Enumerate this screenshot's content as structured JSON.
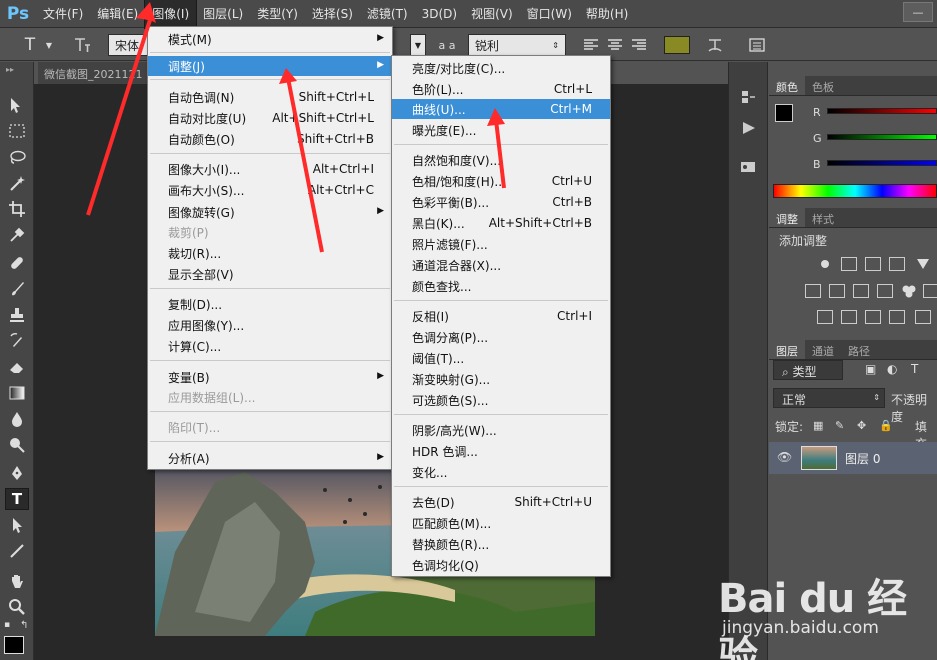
{
  "app": {
    "logo": "Ps"
  },
  "menubar": {
    "items": [
      {
        "label": "文件(F)"
      },
      {
        "label": "编辑(E)"
      },
      {
        "label": "图像(I)"
      },
      {
        "label": "图层(L)"
      },
      {
        "label": "类型(Y)"
      },
      {
        "label": "选择(S)"
      },
      {
        "label": "滤镜(T)"
      },
      {
        "label": "3D(D)"
      },
      {
        "label": "视图(V)"
      },
      {
        "label": "窗口(W)"
      },
      {
        "label": "帮助(H)"
      }
    ],
    "active_index": 2,
    "window_button": "—"
  },
  "options": {
    "tool_icon": "T",
    "font_family": "宋体",
    "aa_icon": "a a",
    "antialias": "锐利",
    "color_swatch": "#8a8a25"
  },
  "document": {
    "tab_title": "微信截图_2021121"
  },
  "image_menu": {
    "items": [
      {
        "label": "模式(M)",
        "shortcut": "",
        "submenu": true,
        "disabled": false
      },
      {
        "label": "调整(J)",
        "shortcut": "",
        "submenu": true,
        "disabled": false,
        "highlighted": true
      },
      {
        "label": "自动色调(N)",
        "shortcut": "Shift+Ctrl+L"
      },
      {
        "label": "自动对比度(U)",
        "shortcut": "Alt+Shift+Ctrl+L"
      },
      {
        "label": "自动颜色(O)",
        "shortcut": "Shift+Ctrl+B"
      },
      {
        "label": "图像大小(I)...",
        "shortcut": "Alt+Ctrl+I"
      },
      {
        "label": "画布大小(S)...",
        "shortcut": "Alt+Ctrl+C"
      },
      {
        "label": "图像旋转(G)",
        "shortcut": "",
        "submenu": true
      },
      {
        "label": "裁剪(P)",
        "shortcut": "",
        "disabled": true
      },
      {
        "label": "裁切(R)...",
        "shortcut": ""
      },
      {
        "label": "显示全部(V)",
        "shortcut": ""
      },
      {
        "label": "复制(D)...",
        "shortcut": ""
      },
      {
        "label": "应用图像(Y)...",
        "shortcut": ""
      },
      {
        "label": "计算(C)...",
        "shortcut": ""
      },
      {
        "label": "变量(B)",
        "shortcut": "",
        "submenu": true
      },
      {
        "label": "应用数据组(L)...",
        "shortcut": "",
        "disabled": true
      },
      {
        "label": "陷印(T)...",
        "shortcut": "",
        "disabled": true
      },
      {
        "label": "分析(A)",
        "shortcut": "",
        "submenu": true
      }
    ]
  },
  "adjust_menu": {
    "items": [
      {
        "label": "亮度/对比度(C)...",
        "shortcut": ""
      },
      {
        "label": "色阶(L)...",
        "shortcut": "Ctrl+L"
      },
      {
        "label": "曲线(U)...",
        "shortcut": "Ctrl+M",
        "highlighted": true
      },
      {
        "label": "曝光度(E)...",
        "shortcut": ""
      },
      {
        "label": "自然饱和度(V)...",
        "shortcut": ""
      },
      {
        "label": "色相/饱和度(H)...",
        "shortcut": "Ctrl+U"
      },
      {
        "label": "色彩平衡(B)...",
        "shortcut": "Ctrl+B"
      },
      {
        "label": "黑白(K)...",
        "shortcut": "Alt+Shift+Ctrl+B"
      },
      {
        "label": "照片滤镜(F)...",
        "shortcut": ""
      },
      {
        "label": "通道混合器(X)...",
        "shortcut": ""
      },
      {
        "label": "颜色查找...",
        "shortcut": ""
      },
      {
        "label": "反相(I)",
        "shortcut": "Ctrl+I"
      },
      {
        "label": "色调分离(P)...",
        "shortcut": ""
      },
      {
        "label": "阈值(T)...",
        "shortcut": ""
      },
      {
        "label": "渐变映射(G)...",
        "shortcut": ""
      },
      {
        "label": "可选颜色(S)...",
        "shortcut": ""
      },
      {
        "label": "阴影/高光(W)...",
        "shortcut": ""
      },
      {
        "label": "HDR 色调...",
        "shortcut": ""
      },
      {
        "label": "变化...",
        "shortcut": ""
      },
      {
        "label": "去色(D)",
        "shortcut": "Shift+Ctrl+U"
      },
      {
        "label": "匹配颜色(M)...",
        "shortcut": ""
      },
      {
        "label": "替换颜色(R)...",
        "shortcut": ""
      },
      {
        "label": "色调均化(Q)",
        "shortcut": ""
      }
    ]
  },
  "panels": {
    "color_tabs": [
      "颜色",
      "色板"
    ],
    "channels": [
      "R",
      "G",
      "B"
    ],
    "adjust_tabs": [
      "调整",
      "样式"
    ],
    "add_adjust_label": "添加调整",
    "layer_tabs": [
      "图层",
      "通道",
      "路径"
    ],
    "filter_kind": "类型",
    "blend_mode": "正常",
    "opacity_label": "不透明度",
    "lock_label": "锁定:",
    "fill_label": "填充",
    "layer_name": "图层 0"
  },
  "watermark": {
    "brand": "Bai du 经验",
    "url": "jingyan.baidu.com"
  },
  "colors": {
    "accent": "#3b8fd6",
    "arrow": "#ff2a2a"
  }
}
